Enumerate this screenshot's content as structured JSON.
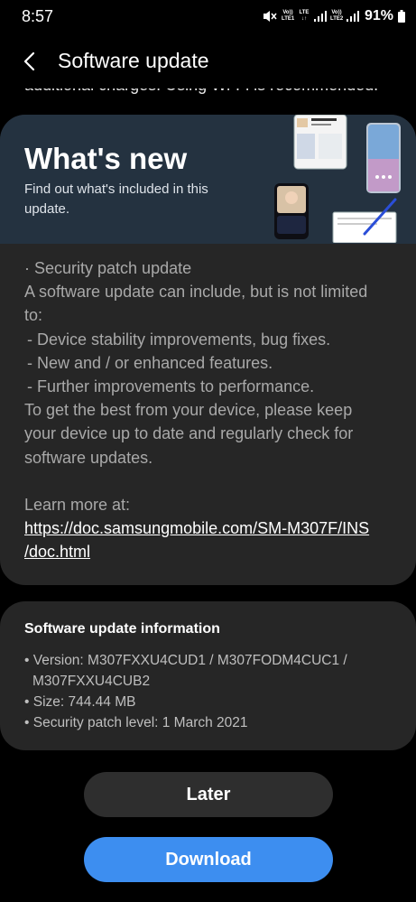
{
  "status_bar": {
    "time": "8:57",
    "net1_top": "Vo))",
    "net1_bottom": "LTE1",
    "lte": "LTE",
    "net2_top": "Vo))",
    "net2_bottom": "LTE2",
    "battery": "91%",
    "icons": [
      "mute-icon",
      "signal-icon",
      "signal-icon",
      "battery-icon"
    ]
  },
  "header": {
    "back_icon": "back-arrow-icon",
    "title": "Software update"
  },
  "clipped_text": "additional charges. Using Wi-Fi is recommended.",
  "whats_new": {
    "title": "What's new",
    "subtitle": "Find out what's included in this update."
  },
  "update_notes": {
    "lines": [
      "· Security patch update",
      "A software update can include, but is not limited",
      "to:",
      " - Device stability improvements, bug fixes.",
      " - New and / or enhanced features.",
      " - Further improvements to performance.",
      "To get the best from your device, please keep",
      "your device up to date and regularly check for",
      "software updates."
    ],
    "learn_more_label": "Learn more at:",
    "link_line1": "https://doc.samsungmobile.com/SM-M307F/INS",
    "link_line2": "/doc.html"
  },
  "info": {
    "title": "Software update information",
    "lines": [
      "• Version: M307FXXU4CUD1 / M307FODM4CUC1 /",
      "  M307FXXU4CUB2",
      "• Size: 744.44 MB",
      "• Security patch level: 1 March 2021"
    ]
  },
  "buttons": {
    "later": "Later",
    "download": "Download"
  },
  "colors": {
    "background": "#000000",
    "card": "#262626",
    "banner": "#243240",
    "primary_button": "#3d8ef0",
    "secondary_button": "#2e2e2e"
  }
}
